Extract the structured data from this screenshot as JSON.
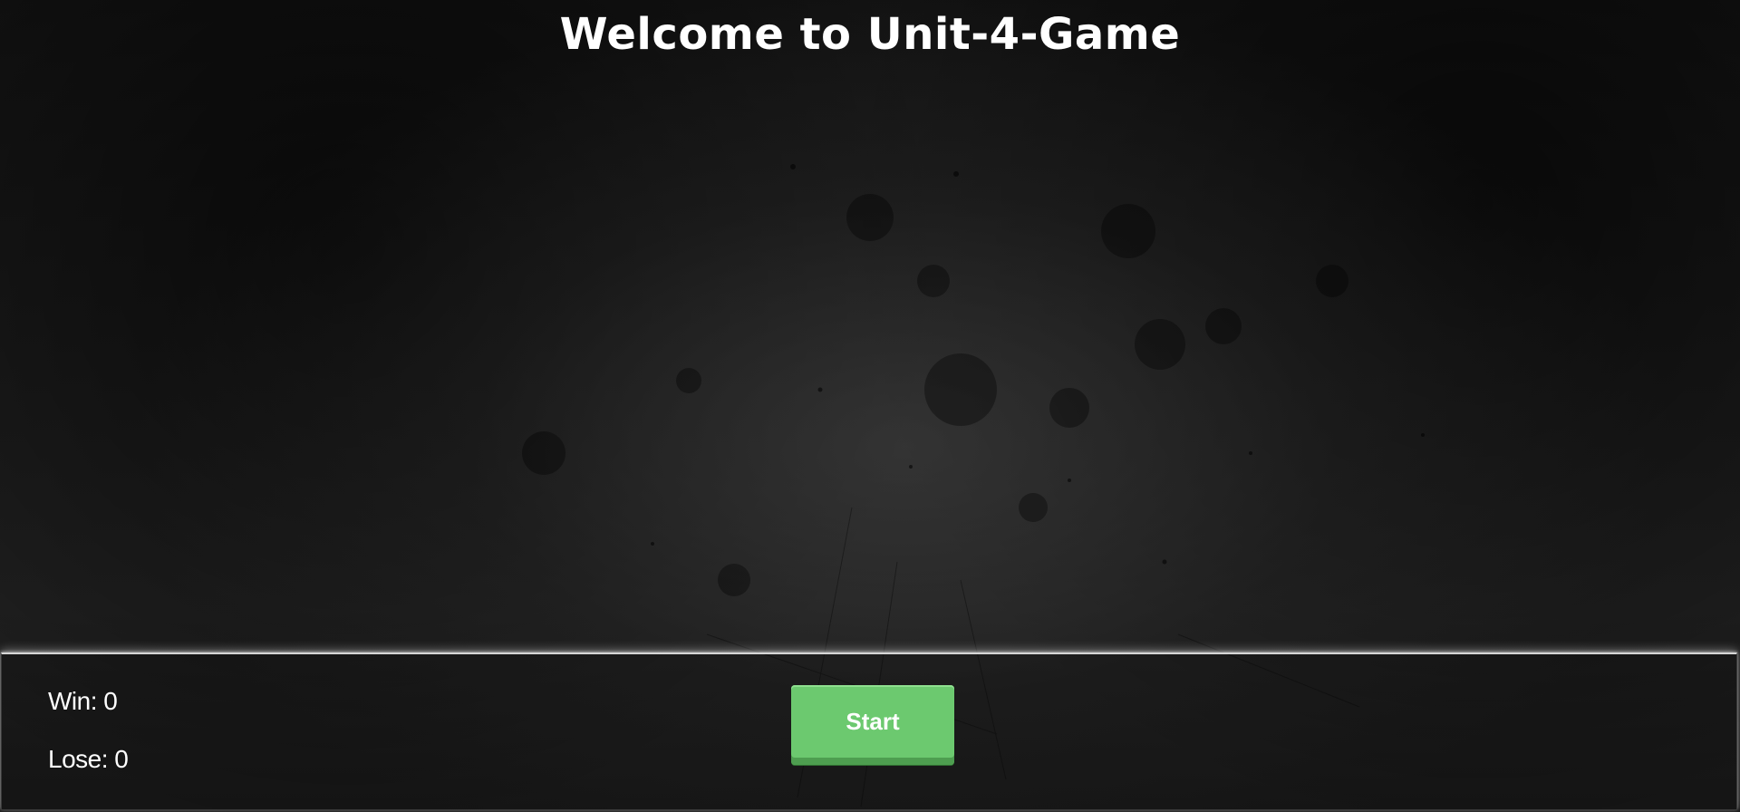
{
  "header": {
    "title": "Welcome to Unit-4-Game"
  },
  "scoreboard": {
    "win_label": "Win:",
    "win_value": "0",
    "lose_label": "Lose:",
    "lose_value": "0"
  },
  "controls": {
    "start_label": "Start"
  },
  "colors": {
    "background": "#151515",
    "panel_border": "#d6d6d6",
    "start_button": "#6cc96f",
    "text": "#ffffff"
  }
}
